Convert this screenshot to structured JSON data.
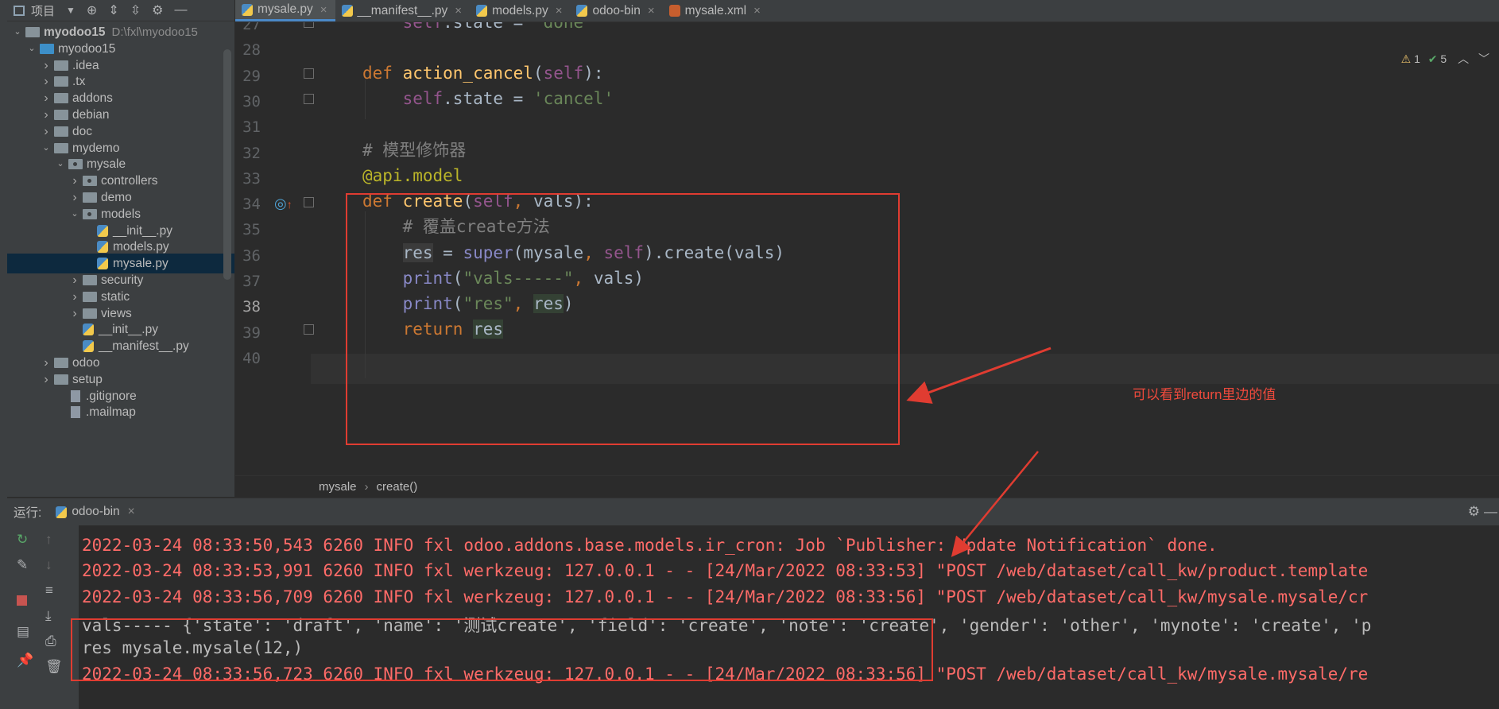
{
  "project_panel": {
    "title": "项目",
    "tree": [
      {
        "label": "myodoo15",
        "hint": "D:\\fxl\\myodoo15",
        "level": 0,
        "expanded": true,
        "type": "folder",
        "bold": true
      },
      {
        "label": "myodoo15",
        "level": 1,
        "expanded": true,
        "type": "folder-blue"
      },
      {
        "label": ".idea",
        "level": 2,
        "expanded": false,
        "type": "folder"
      },
      {
        "label": ".tx",
        "level": 2,
        "expanded": false,
        "type": "folder"
      },
      {
        "label": "addons",
        "level": 2,
        "expanded": false,
        "type": "folder"
      },
      {
        "label": "debian",
        "level": 2,
        "expanded": false,
        "type": "folder"
      },
      {
        "label": "doc",
        "level": 2,
        "expanded": false,
        "type": "folder"
      },
      {
        "label": "mydemo",
        "level": 2,
        "expanded": true,
        "type": "folder"
      },
      {
        "label": "mysale",
        "level": 3,
        "expanded": true,
        "type": "package"
      },
      {
        "label": "controllers",
        "level": 4,
        "expanded": false,
        "type": "package"
      },
      {
        "label": "demo",
        "level": 4,
        "expanded": false,
        "type": "folder"
      },
      {
        "label": "models",
        "level": 4,
        "expanded": true,
        "type": "package"
      },
      {
        "label": "__init__.py",
        "level": 5,
        "type": "py"
      },
      {
        "label": "models.py",
        "level": 5,
        "type": "py"
      },
      {
        "label": "mysale.py",
        "level": 5,
        "type": "py",
        "selected": true
      },
      {
        "label": "security",
        "level": 4,
        "expanded": false,
        "type": "folder"
      },
      {
        "label": "static",
        "level": 4,
        "expanded": false,
        "type": "folder"
      },
      {
        "label": "views",
        "level": 4,
        "expanded": false,
        "type": "folder"
      },
      {
        "label": "__init__.py",
        "level": 4,
        "type": "py",
        "noarrow": true
      },
      {
        "label": "__manifest__.py",
        "level": 4,
        "type": "py",
        "noarrow": true
      },
      {
        "label": "odoo",
        "level": 2,
        "expanded": false,
        "type": "folder"
      },
      {
        "label": "setup",
        "level": 2,
        "expanded": false,
        "type": "folder"
      },
      {
        "label": ".gitignore",
        "level": 3,
        "type": "file",
        "noarrow": true
      },
      {
        "label": ".mailmap",
        "level": 3,
        "type": "file",
        "noarrow": true
      }
    ]
  },
  "tabs": [
    {
      "label": "mysale.py",
      "active": true,
      "icon": "python"
    },
    {
      "label": "__manifest__.py",
      "icon": "python"
    },
    {
      "label": "models.py",
      "icon": "python"
    },
    {
      "label": "odoo-bin",
      "icon": "python"
    },
    {
      "label": "mysale.xml",
      "icon": "xml"
    }
  ],
  "inspection": {
    "warnings": "1",
    "ok": "5"
  },
  "editor": {
    "line_numbers": [
      "27",
      "28",
      "29",
      "30",
      "31",
      "32",
      "33",
      "34",
      "35",
      "36",
      "37",
      "38",
      "39",
      "40"
    ],
    "current_line": "38"
  },
  "breadcrumb": [
    "mysale",
    "create()"
  ],
  "annotation": "可以看到return里边的值",
  "run_panel": {
    "label": "运行:",
    "tab": "odoo-bin",
    "console_lines": [
      {
        "text": "2022-03-24 08:33:50,543 6260 INFO fxl odoo.addons.base.models.ir_cron: Job `Publisher: Update Notification` done.",
        "style": "log"
      },
      {
        "text": "2022-03-24 08:33:53,991 6260 INFO fxl werkzeug: 127.0.0.1 - - [24/Mar/2022 08:33:53] \"POST /web/dataset/call_kw/product.template",
        "style": "log"
      },
      {
        "text": "2022-03-24 08:33:56,709 6260 INFO fxl werkzeug: 127.0.0.1 - - [24/Mar/2022 08:33:56] \"POST /web/dataset/call_kw/mysale.mysale/cr",
        "style": "log"
      },
      {
        "text": "vals----- {'state': 'draft', 'name': '测试create', 'field': 'create', 'note': 'create', 'gender': 'other', 'mynote': 'create', 'p",
        "style": "plain"
      },
      {
        "text": "res mysale.mysale(12,)",
        "style": "plain"
      },
      {
        "text": "2022-03-24 08:33:56,723 6260 INFO fxl werkzeug: 127.0.0.1 - - [24/Mar/2022 08:33:56] \"POST /web/dataset/call_kw/mysale.mysale/re",
        "style": "log"
      }
    ]
  },
  "colors": {
    "accent": "#4a88c7",
    "annotation_red": "#e03c31",
    "log_red": "#ff6b68"
  }
}
